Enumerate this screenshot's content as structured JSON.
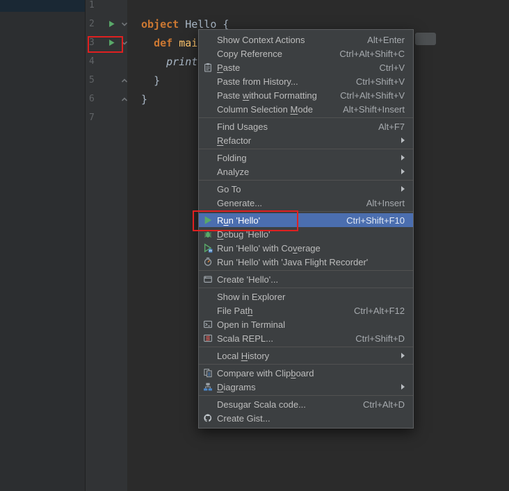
{
  "colors": {
    "editor_bg": "#2b2b2b",
    "gutter_bg": "#313335",
    "menu_bg": "#3c3f41",
    "selection_blue": "#4b6eaf",
    "run_green": "#59A869",
    "keyword_orange": "#cc7832",
    "function_yellow": "#ffc66d",
    "annotation_red": "#e02020"
  },
  "editor": {
    "lines": [
      {
        "num": "1",
        "indent": 0,
        "segments": []
      },
      {
        "num": "2",
        "indent": 0,
        "run": true,
        "fold": "down",
        "segments": [
          {
            "text": "object ",
            "style": "keyword"
          },
          {
            "text": "Hello {",
            "style": "plain"
          }
        ]
      },
      {
        "num": "3",
        "indent": 2,
        "run": true,
        "fold": "down",
        "segments": [
          {
            "text": "def ",
            "style": "keyword"
          },
          {
            "text": "main",
            "style": "function"
          }
        ]
      },
      {
        "num": "4",
        "indent": 4,
        "segments": [
          {
            "text": "println",
            "style": "italic"
          }
        ]
      },
      {
        "num": "5",
        "indent": 2,
        "fold": "up",
        "segments": [
          {
            "text": "}",
            "style": "plain"
          }
        ]
      },
      {
        "num": "6",
        "indent": 0,
        "fold": "up",
        "segments": [
          {
            "text": "}",
            "style": "plain"
          }
        ]
      },
      {
        "num": "7",
        "indent": 0,
        "segments": []
      }
    ]
  },
  "menu": {
    "items": [
      {
        "label": "Show Context Actions",
        "shortcut": "Alt+Enter"
      },
      {
        "label": "Copy Reference",
        "shortcut": "Ctrl+Alt+Shift+C"
      },
      {
        "label": "Paste",
        "shortcut": "Ctrl+V",
        "icon": "paste",
        "mnemonic": "P"
      },
      {
        "label": "Paste from History...",
        "shortcut": "Ctrl+Shift+V"
      },
      {
        "label": "Paste without Formatting",
        "shortcut": "Ctrl+Alt+Shift+V",
        "mnemonic": "w"
      },
      {
        "label": "Column Selection Mode",
        "shortcut": "Alt+Shift+Insert",
        "mnemonic": "M"
      },
      {
        "separator": true
      },
      {
        "label": "Find Usages",
        "shortcut": "Alt+F7"
      },
      {
        "label": "Refactor",
        "submenu": true,
        "mnemonic": "R"
      },
      {
        "separator": true
      },
      {
        "label": "Folding",
        "submenu": true
      },
      {
        "label": "Analyze",
        "submenu": true
      },
      {
        "separator": true
      },
      {
        "label": "Go To",
        "submenu": true
      },
      {
        "label": "Generate...",
        "shortcut": "Alt+Insert"
      },
      {
        "separator": true
      },
      {
        "label": "Run 'Hello'",
        "shortcut": "Ctrl+Shift+F10",
        "icon": "run",
        "selected": true,
        "mnemonic": "u"
      },
      {
        "label": "Debug 'Hello'",
        "icon": "debug",
        "mnemonic": "D"
      },
      {
        "label": "Run 'Hello' with Coverage",
        "icon": "coverage",
        "mnemonic": "v"
      },
      {
        "label": "Run 'Hello' with 'Java Flight Recorder'",
        "icon": "profiler"
      },
      {
        "separator": true
      },
      {
        "label": "Create 'Hello'...",
        "icon": "run-config"
      },
      {
        "separator": true
      },
      {
        "label": "Show in Explorer"
      },
      {
        "label": "File Path",
        "shortcut": "Ctrl+Alt+F12",
        "mnemonic": "h"
      },
      {
        "label": "Open in Terminal",
        "icon": "terminal"
      },
      {
        "label": "Scala REPL...",
        "shortcut": "Ctrl+Shift+D",
        "icon": "scala-repl"
      },
      {
        "separator": true
      },
      {
        "label": "Local History",
        "submenu": true,
        "mnemonic": "H"
      },
      {
        "separator": true
      },
      {
        "label": "Compare with Clipboard",
        "icon": "compare",
        "mnemonic": "b"
      },
      {
        "label": "Diagrams",
        "submenu": true,
        "icon": "diagrams",
        "mnemonic": "D"
      },
      {
        "separator": true
      },
      {
        "label": "Desugar Scala code...",
        "shortcut": "Ctrl+Alt+D"
      },
      {
        "label": "Create Gist...",
        "icon": "github"
      }
    ]
  },
  "annotations": {
    "color": "#e02020",
    "boxes": [
      {
        "target": "gutter-run-icon-line-3"
      },
      {
        "target": "menu-item-run-hello"
      }
    ]
  }
}
